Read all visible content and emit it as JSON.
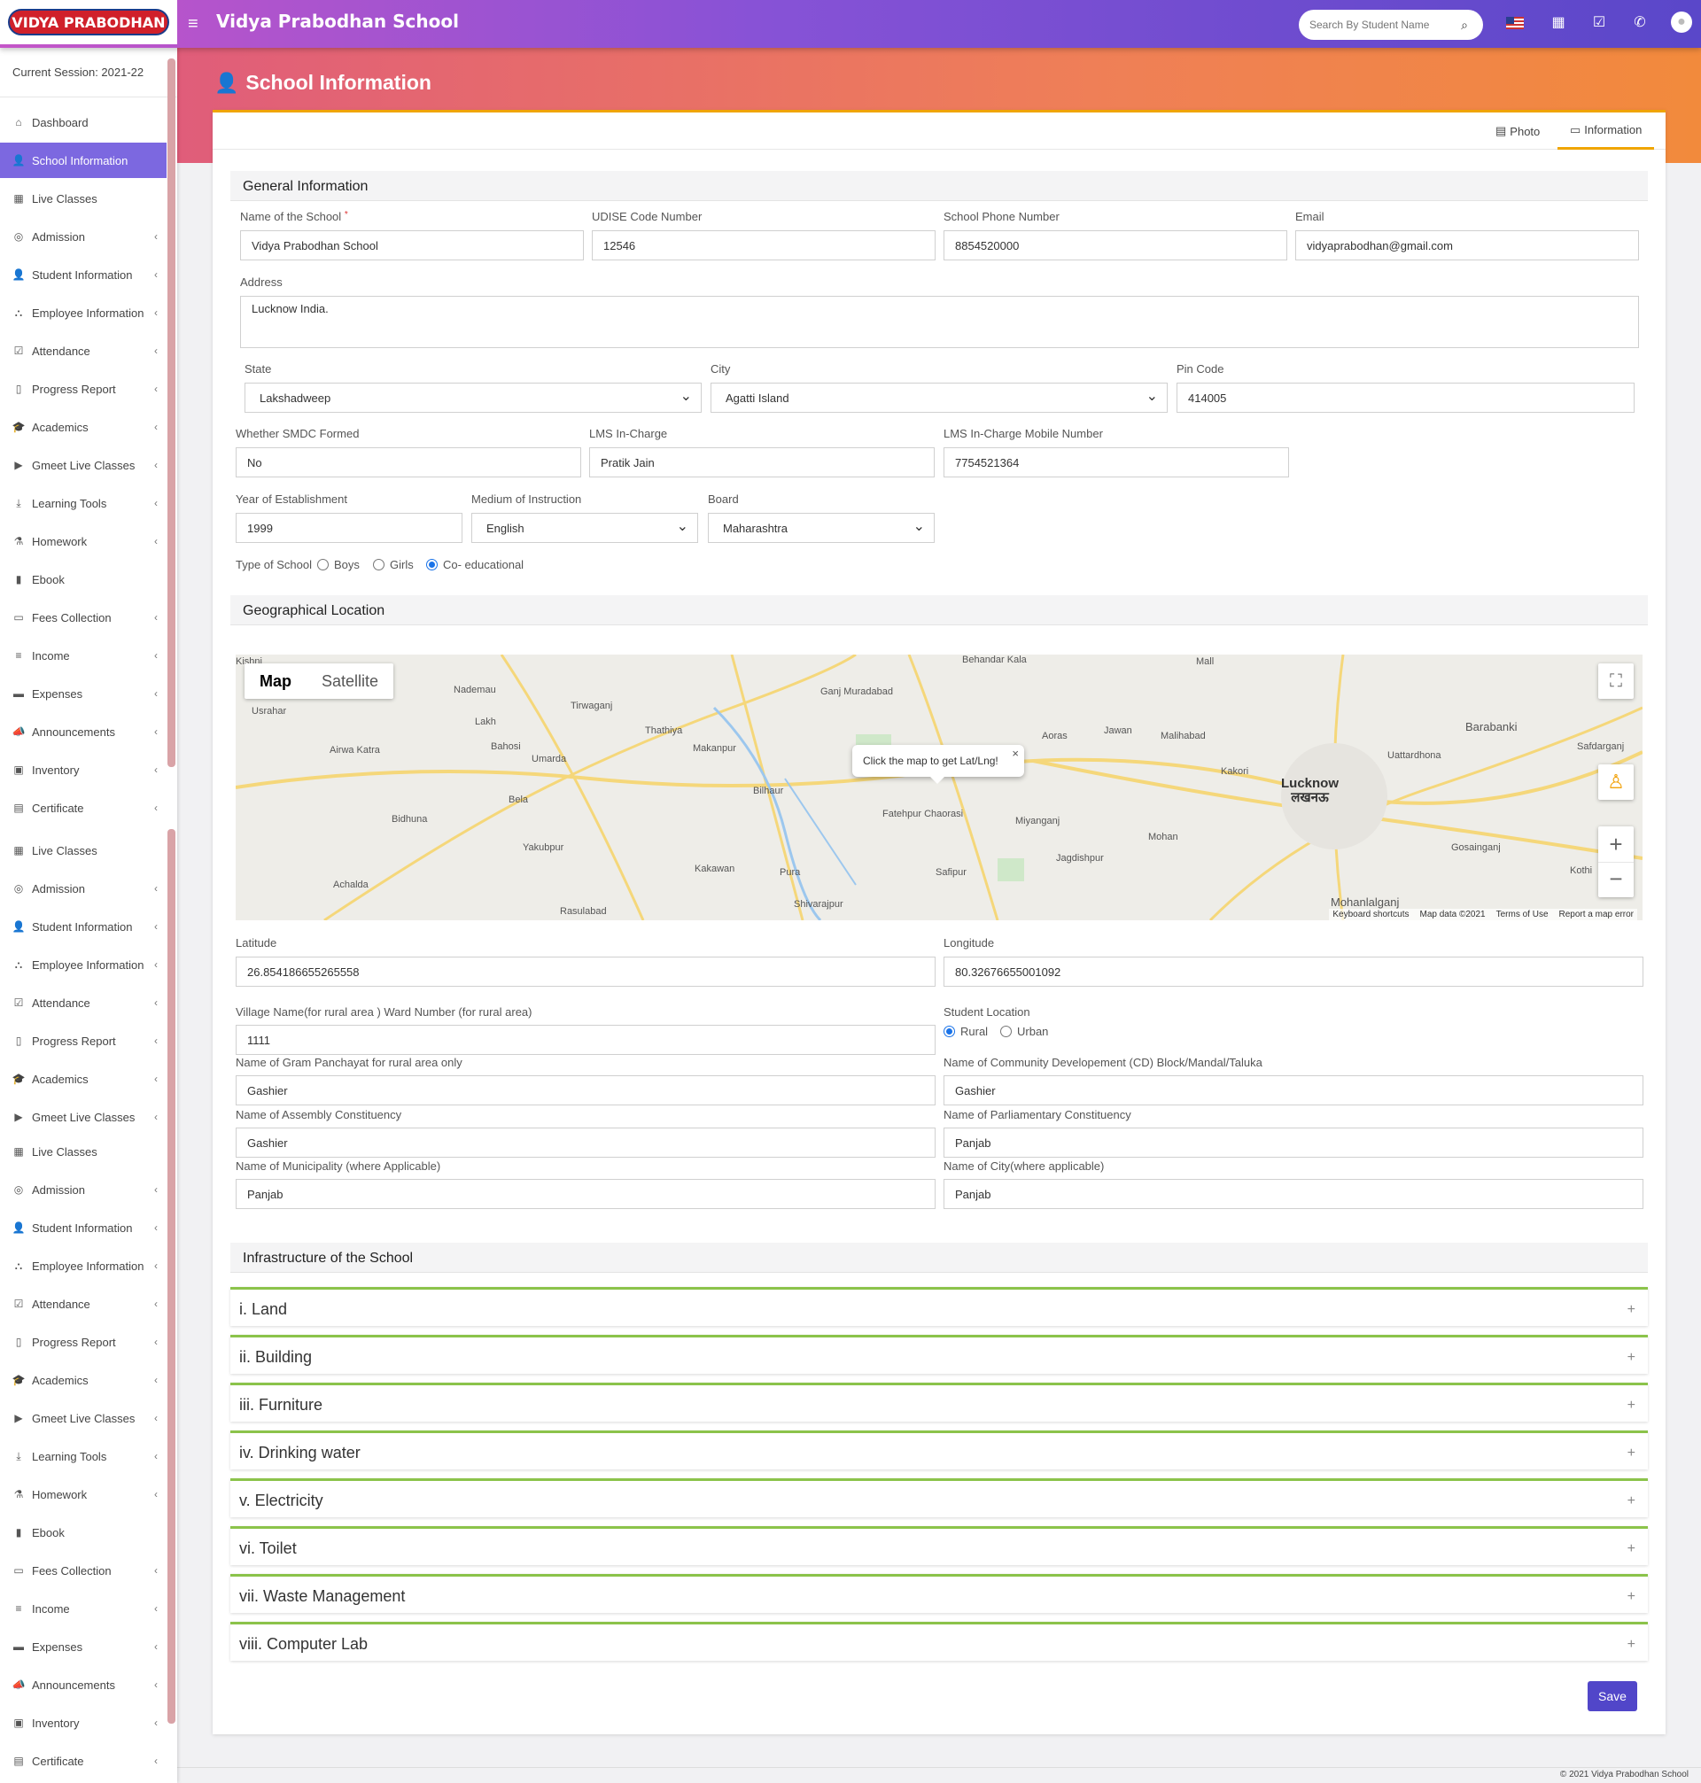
{
  "header": {
    "logo_text": "VIDYA PRABODHAN",
    "app_title": "Vidya Prabodhan School",
    "search_placeholder": "Search By Student Name"
  },
  "sidebar": {
    "session": "Current Session: 2021-22",
    "items": [
      {
        "label": "Dashboard",
        "icon": "home-icon",
        "chev": false,
        "active": false
      },
      {
        "label": "School Information",
        "icon": "user-plus-icon",
        "chev": false,
        "active": true
      },
      {
        "label": "Live Classes",
        "icon": "calendar-icon",
        "chev": false,
        "active": false
      },
      {
        "label": "Admission",
        "icon": "admission-icon",
        "chev": true,
        "active": false
      },
      {
        "label": "Student Information",
        "icon": "user-plus-icon",
        "chev": true,
        "active": false
      },
      {
        "label": "Employee Information",
        "icon": "sitemap-icon",
        "chev": true,
        "active": false
      },
      {
        "label": "Attendance",
        "icon": "calendar-check-icon",
        "chev": true,
        "active": false
      },
      {
        "label": "Progress Report",
        "icon": "map-icon",
        "chev": true,
        "active": false
      },
      {
        "label": "Academics",
        "icon": "graduation-cap-icon",
        "chev": true,
        "active": false
      },
      {
        "label": "Gmeet Live Classes",
        "icon": "video-icon",
        "chev": true,
        "active": false
      },
      {
        "label": "Learning Tools",
        "icon": "download-icon",
        "chev": true,
        "active": false
      },
      {
        "label": "Homework",
        "icon": "flask-icon",
        "chev": true,
        "active": false
      },
      {
        "label": "Ebook",
        "icon": "book-icon",
        "chev": false,
        "active": false
      },
      {
        "label": "Fees Collection",
        "icon": "money-icon",
        "chev": true,
        "active": false
      },
      {
        "label": "Income",
        "icon": "list-icon",
        "chev": true,
        "active": false
      },
      {
        "label": "Expenses",
        "icon": "credit-card-icon",
        "chev": true,
        "active": false
      },
      {
        "label": "Announcements",
        "icon": "bullhorn-icon",
        "chev": true,
        "active": false
      },
      {
        "label": "Inventory",
        "icon": "inventory-icon",
        "chev": true,
        "active": false
      },
      {
        "label": "Certificate",
        "icon": "certificate-icon",
        "chev": true,
        "active": false
      },
      {
        "label": "Live Classes",
        "icon": "calendar-icon",
        "chev": false,
        "active": false
      },
      {
        "label": "Admission",
        "icon": "admission-icon",
        "chev": true,
        "active": false
      },
      {
        "label": "Student Information",
        "icon": "user-plus-icon",
        "chev": true,
        "active": false
      },
      {
        "label": "Employee Information",
        "icon": "sitemap-icon",
        "chev": true,
        "active": false
      },
      {
        "label": "Attendance",
        "icon": "calendar-check-icon",
        "chev": true,
        "active": false
      },
      {
        "label": "Progress Report",
        "icon": "map-icon",
        "chev": true,
        "active": false
      },
      {
        "label": "Academics",
        "icon": "graduation-cap-icon",
        "chev": true,
        "active": false
      },
      {
        "label": "Gmeet Live Classes",
        "icon": "video-icon",
        "chev": true,
        "active": false
      },
      {
        "label": "Live Classes",
        "icon": "calendar-icon",
        "chev": false,
        "active": false
      },
      {
        "label": "Admission",
        "icon": "admission-icon",
        "chev": true,
        "active": false
      },
      {
        "label": "Student Information",
        "icon": "user-plus-icon",
        "chev": true,
        "active": false
      },
      {
        "label": "Employee Information",
        "icon": "sitemap-icon",
        "chev": true,
        "active": false
      },
      {
        "label": "Attendance",
        "icon": "calendar-check-icon",
        "chev": true,
        "active": false
      },
      {
        "label": "Progress Report",
        "icon": "map-icon",
        "chev": true,
        "active": false
      },
      {
        "label": "Academics",
        "icon": "graduation-cap-icon",
        "chev": true,
        "active": false
      },
      {
        "label": "Gmeet Live Classes",
        "icon": "video-icon",
        "chev": true,
        "active": false
      },
      {
        "label": "Learning Tools",
        "icon": "download-icon",
        "chev": true,
        "active": false
      },
      {
        "label": "Homework",
        "icon": "flask-icon",
        "chev": true,
        "active": false
      },
      {
        "label": "Ebook",
        "icon": "book-icon",
        "chev": false,
        "active": false
      },
      {
        "label": "Fees Collection",
        "icon": "money-icon",
        "chev": true,
        "active": false
      },
      {
        "label": "Income",
        "icon": "list-icon",
        "chev": true,
        "active": false
      },
      {
        "label": "Expenses",
        "icon": "credit-card-icon",
        "chev": true,
        "active": false
      },
      {
        "label": "Announcements",
        "icon": "bullhorn-icon",
        "chev": true,
        "active": false
      },
      {
        "label": "Inventory",
        "icon": "inventory-icon",
        "chev": true,
        "active": false
      },
      {
        "label": "Certificate",
        "icon": "certificate-icon",
        "chev": true,
        "active": false
      }
    ]
  },
  "page": {
    "title": "School Information",
    "tabs": {
      "photo": "Photo",
      "information": "Information"
    }
  },
  "general": {
    "heading": "General Information",
    "school_name_label": "Name of the School",
    "school_name_required": "*",
    "school_name": "Vidya Prabodhan School",
    "udise_label": "UDISE Code Number",
    "udise": "12546",
    "phone_label": "School Phone Number",
    "phone": "8854520000",
    "email_label": "Email",
    "email": "vidyaprabodhan@gmail.com",
    "address_label": "Address",
    "address": "Lucknow India.",
    "state_label": "State",
    "state": "Lakshadweep",
    "city_label": "City",
    "city": "Agatti Island",
    "pin_label": "Pin Code",
    "pin": "414005",
    "smdc_label": "Whether SMDC Formed",
    "smdc": "No",
    "lms_label": "LMS In-Charge",
    "lms": "Pratik Jain",
    "lms_mobile_label": "LMS In-Charge Mobile Number",
    "lms_mobile": "7754521364",
    "year_label": "Year of Establishment",
    "year": "1999",
    "medium_label": "Medium of Instruction",
    "medium": "English",
    "board_label": "Board",
    "board": "Maharashtra",
    "type_label": "Type of School",
    "type_options": [
      "Boys",
      "Girls",
      "Co- educational"
    ],
    "type_selected": 2
  },
  "geo": {
    "heading": "Geographical Location",
    "map_tab": "Map",
    "satellite_tab": "Satellite",
    "tooltip": "Click the map to get Lat/Lng!",
    "city_name": "Lucknow",
    "city_name_hi": "लखनऊ",
    "places": [
      "Kishni",
      "Nademau",
      "Usrahar",
      "Tirwaganj",
      "Thathiya",
      "Ganj Muradabad",
      "Behandar Kala",
      "Mall",
      "Lakh",
      "Bahosi",
      "Umarda",
      "Airwa Katra",
      "Makanpur",
      "Bilhaur",
      "Bela",
      "Bidhuna",
      "Yakubpur",
      "Achalda",
      "Rasulabad",
      "Kakawan",
      "Pura",
      "Shivarajpur",
      "Fatehpur Chaorasi",
      "Safipur",
      "Miyanganj",
      "Jagdishpur",
      "Aoras",
      "Jawan",
      "Malihabad",
      "Kakori",
      "Mohan",
      "Mohanlalganj",
      "Uattardhona",
      "Barabanki",
      "Safdarganj",
      "Gosainganj",
      "Kothi"
    ],
    "map_footer": [
      "Keyboard shortcuts",
      "Map data ©2021",
      "Terms of Use",
      "Report a map error"
    ],
    "latitude_label": "Latitude",
    "latitude": "26.854186655265558",
    "longitude_label": "Longitude",
    "longitude": "80.32676655001092",
    "village_label": "Village Name(for rural area ) Ward Number (for rural area)",
    "village": "1111",
    "student_location_label": "Student Location",
    "student_location_options": [
      "Rural",
      "Urban"
    ],
    "student_location_selected": 0,
    "panchayat_label": "Name of Gram Panchayat for rural area only",
    "panchayat": "Gashier",
    "cd_block_label": "Name of Community Developement (CD) Block/Mandal/Taluka",
    "cd_block": "Gashier",
    "assembly_label": "Name of Assembly Constituency",
    "assembly": "Gashier",
    "parliament_label": "Name of Parliamentary Constituency",
    "parliament": "Panjab",
    "municipality_label": "Name of Municipality (where Applicable)",
    "municipality": "Panjab",
    "city_app_label": "Name of City(where applicable)",
    "city_app": "Panjab"
  },
  "infra": {
    "heading": "Infrastructure of the School",
    "items": [
      "i. Land",
      "ii. Building",
      "iii. Furniture",
      "iv. Drinking water",
      "v. Electricity",
      "vi. Toilet",
      "vii. Waste Management",
      "viii. Computer Lab"
    ]
  },
  "save_label": "Save",
  "footer": "© 2021 Vidya Prabodhan School",
  "colors": {
    "accent": "#7c68e0",
    "save": "#5146c9",
    "accordion": "#8bc34a",
    "tab_active": "#f0a500"
  }
}
